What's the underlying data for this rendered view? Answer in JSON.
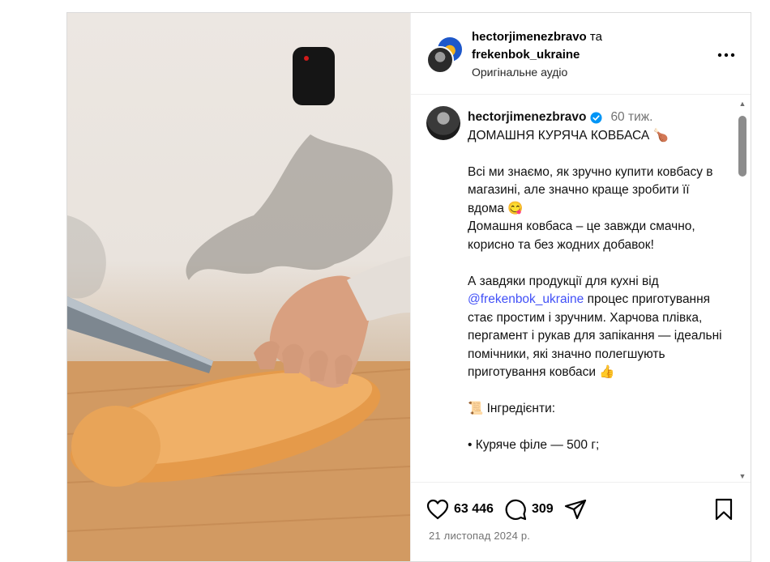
{
  "header": {
    "username": "hectorjimenezbravo",
    "joiner": "та",
    "collaborator": "frekenbok_ukraine",
    "audio": "Оригінальне аудіо",
    "more_icon": "more-horizontal-icon"
  },
  "caption": {
    "username": "hectorjimenezbravo",
    "time": "60 тиж.",
    "title": "ДОМАШНЯ КУРЯЧА КОВБАСА 🍗",
    "p1": "Всі ми знаємо, як зручно купити ковбасу в магазині, але значно краще зробити її вдома 😋",
    "p2": "Домашня ковбаса – це завжди смачно, корисно та без жодних добавок!",
    "p3_before": "А завдяки продукції для кухні від",
    "mention": "@frekenbok_ukraine",
    "p3_after": "процес приготування стає простим і зручним. Харчова плівка, пергамент і рукав для запікання — ідеальні помічники, які значно полегшують приготування ковбаси 👍",
    "ingredients": "📜 Інгредієнти:",
    "item1": "• Куряче філе — 500 г;"
  },
  "actions": {
    "likes": "63 446",
    "comments": "309",
    "date": "21 листопад 2024 р."
  },
  "colors": {
    "mention": "#4150f7",
    "verified": "#0095f6",
    "muted": "#737373"
  }
}
